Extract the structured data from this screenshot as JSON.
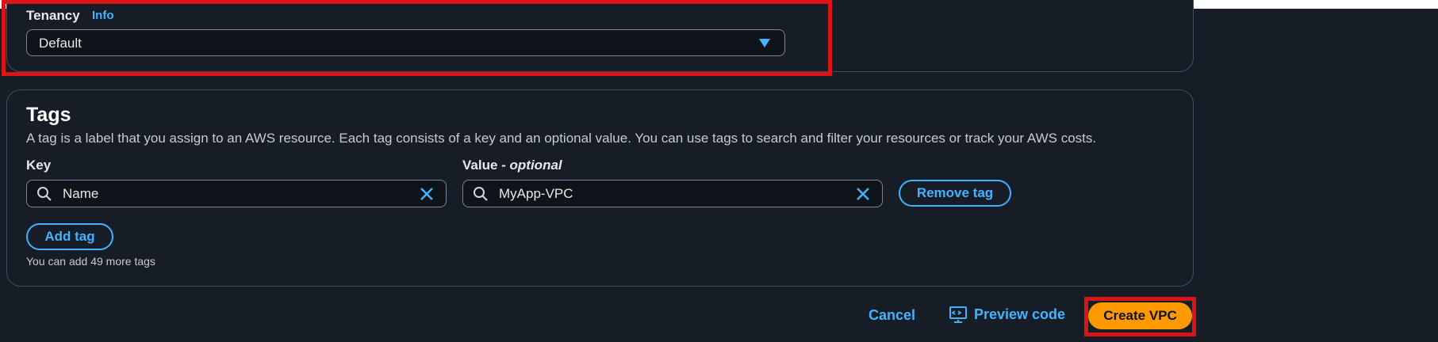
{
  "tenancy": {
    "label": "Tenancy",
    "info_link": "Info",
    "selected_value": "Default"
  },
  "tags": {
    "heading": "Tags",
    "description": "A tag is a label that you assign to an AWS resource. Each tag consists of a key and an optional value. You can use tags to search and filter your resources or track your AWS costs.",
    "key_label": "Key",
    "value_label": "Value - ",
    "value_label_optional": "optional",
    "key_value": "Name",
    "value_value": "MyApp-VPC",
    "remove_tag_label": "Remove tag",
    "add_tag_label": "Add tag",
    "remaining_hint": "You can add 49 more tags"
  },
  "footer": {
    "cancel_label": "Cancel",
    "preview_code_label": "Preview code",
    "create_label": "Create VPC"
  },
  "colors": {
    "background": "#161d26",
    "accent_link": "#42b4ff",
    "primary_button": "#ff9900",
    "highlight_box": "#d91515"
  },
  "icons": [
    "chevron-down-icon",
    "search-icon",
    "clear-icon",
    "preview-code-icon"
  ]
}
